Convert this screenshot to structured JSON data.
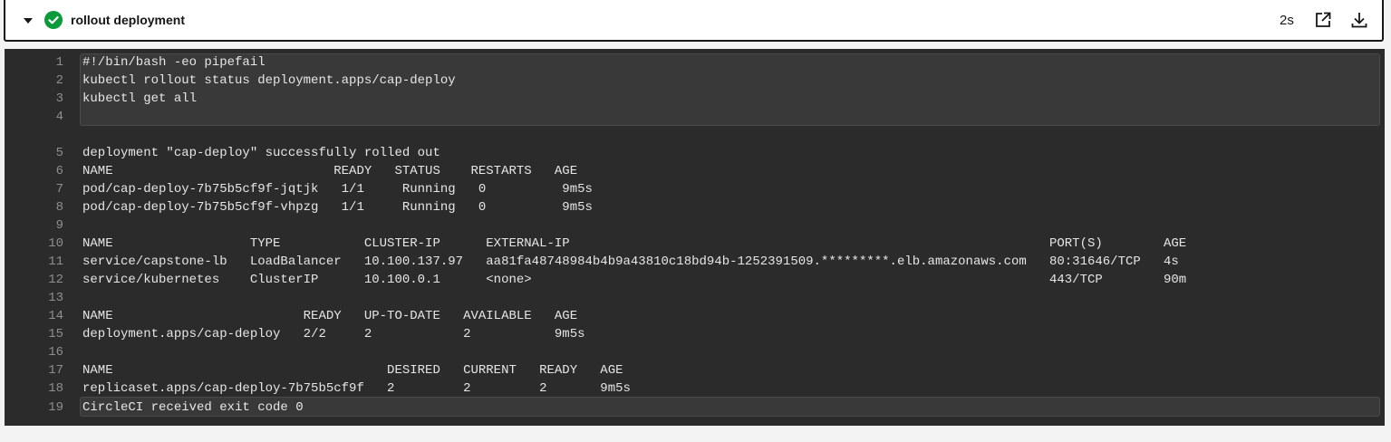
{
  "step": {
    "title": "rollout deployment",
    "duration": "2s",
    "icons": {
      "collapse": "caret-down-icon",
      "status": "success-check-icon",
      "open": "open-external-icon",
      "download": "download-icon"
    },
    "colors": {
      "success": "#0b9b3b",
      "terminal_bg": "#2b2b2b"
    }
  },
  "log": {
    "lines": [
      {
        "n": "1",
        "text": "#!/bin/bash -eo pipefail"
      },
      {
        "n": "2",
        "text": "kubectl rollout status deployment.apps/cap-deploy"
      },
      {
        "n": "3",
        "text": "kubectl get all"
      },
      {
        "n": "4",
        "text": ""
      },
      {
        "n": "5",
        "text": "deployment \"cap-deploy\" successfully rolled out"
      },
      {
        "n": "6",
        "text": "NAME                             READY   STATUS    RESTARTS   AGE"
      },
      {
        "n": "7",
        "text": "pod/cap-deploy-7b75b5cf9f-jqtjk   1/1     Running   0          9m5s"
      },
      {
        "n": "8",
        "text": "pod/cap-deploy-7b75b5cf9f-vhpzg   1/1     Running   0          9m5s"
      },
      {
        "n": "9",
        "text": ""
      },
      {
        "n": "10",
        "text": "NAME                  TYPE           CLUSTER-IP      EXTERNAL-IP                                                               PORT(S)        AGE"
      },
      {
        "n": "11",
        "text": "service/capstone-lb   LoadBalancer   10.100.137.97   aa81fa48748984b4b9a43810c18bd94b-1252391509.*********.elb.amazonaws.com   80:31646/TCP   4s"
      },
      {
        "n": "12",
        "text": "service/kubernetes    ClusterIP      10.100.0.1      <none>                                                                    443/TCP        90m"
      },
      {
        "n": "13",
        "text": ""
      },
      {
        "n": "14",
        "text": "NAME                         READY   UP-TO-DATE   AVAILABLE   AGE"
      },
      {
        "n": "15",
        "text": "deployment.apps/cap-deploy   2/2     2            2           9m5s"
      },
      {
        "n": "16",
        "text": ""
      },
      {
        "n": "17",
        "text": "NAME                                    DESIRED   CURRENT   READY   AGE"
      },
      {
        "n": "18",
        "text": "replicaset.apps/cap-deploy-7b75b5cf9f   2         2         2       9m5s"
      },
      {
        "n": "19",
        "text": "CircleCI received exit code 0"
      }
    ]
  }
}
